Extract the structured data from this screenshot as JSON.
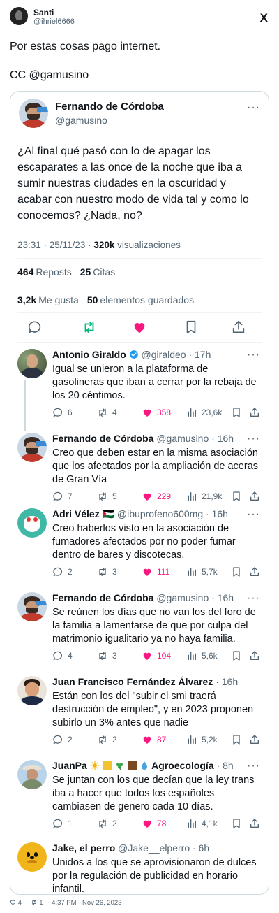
{
  "outer": {
    "name": "Santi",
    "handle": "@ihriel6666",
    "logo": "X",
    "line1": "Por estas cosas pago internet.",
    "line2": "CC @gamusino"
  },
  "quoted": {
    "name": "Fernando de Córdoba",
    "handle": "@gamusino",
    "text": "¿Al final qué pasó con lo de apagar los escaparates a las once de la noche que iba a sumir nuestras ciudades en la oscuridad y acabar con nuestro modo de vida tal y como lo conocemos? ¿Nada, no?",
    "time": "23:31 · 25/11/23 · ",
    "views_count": "320k",
    "views_label": " visualizaciones",
    "reposts_count": "464",
    "reposts_label": "Reposts",
    "quotes_count": "25",
    "quotes_label": "Citas",
    "likes_count": "3,2k",
    "likes_label": "Me gusta",
    "bookmarks_count": "50",
    "bookmarks_label": "elementos guardados"
  },
  "replies": [
    {
      "name": "Antonio Giraldo",
      "handle": "@giraldeo",
      "time": "· 17h",
      "verified": true,
      "text": "Igual se unieron a la plataforma de gasolineras que iban a cerrar por la rebaja de los 20 céntimos.",
      "replies": "6",
      "reposts": "4",
      "likes": "358",
      "views": "23,6k"
    },
    {
      "name": "Fernando de Córdoba",
      "handle": "@gamusino",
      "time": "· 16h",
      "text": "Creo que deben estar en la misma asociación que los afectados por la ampliación de aceras de Gran Vía",
      "replies": "7",
      "reposts": "5",
      "likes": "229",
      "views": "21,9k"
    },
    {
      "name": "Adri Vélez",
      "flag": "🇵🇸",
      "handle": "@ibuprofeno600mg",
      "time": "· 16h",
      "text": "Creo haberlos visto en la asociación de fumadores afectados por no poder fumar dentro de bares y discotecas.",
      "replies": "2",
      "reposts": "3",
      "likes": "111",
      "views": "5,7k"
    },
    {
      "name": "Fernando de Córdoba",
      "handle": "@gamusino",
      "time": "· 16h",
      "text": "Se reúnen los días que no van los del foro de la familia a lamentarse de que por culpa del matrimonio igualitario ya no haya familia.",
      "replies": "4",
      "reposts": "3",
      "likes": "104",
      "views": "5,6k"
    },
    {
      "name": "Juan Francisco Fernández Álvarez",
      "handle": "",
      "time": "· 16h",
      "text": "Están con los del \"subir el smi traerá destrucción de empleo\", y en 2023 proponen subirlo un 3% antes que nadie",
      "replies": "2",
      "reposts": "2",
      "likes": "87",
      "views": "5,2k"
    },
    {
      "name": "JuanPa",
      "name_suffix": "Agroecología",
      "handle": "",
      "time": "· 8h",
      "text": "Se juntan con los que decían que la ley trans iba a hacer que todos los españoles cambiasen de genero cada 10 días.",
      "replies": "1",
      "reposts": "2",
      "likes": "78",
      "views": "4,1k"
    },
    {
      "name": "Jake, el perro",
      "handle": "@Jake__elperro",
      "time": "· 6h",
      "text": "Unidos a los que se aprovisionaron de dulces por la regulación de publicidad en horario infantil."
    }
  ],
  "footer": {
    "likes": "4",
    "retweets": "1",
    "timestamp": "4:37 PM · Nov 26, 2023"
  },
  "colors": {
    "like_pink": "#f91880",
    "repost_green": "#00ba7c",
    "verified_blue": "#1d9bf0",
    "muted": "#536471"
  }
}
